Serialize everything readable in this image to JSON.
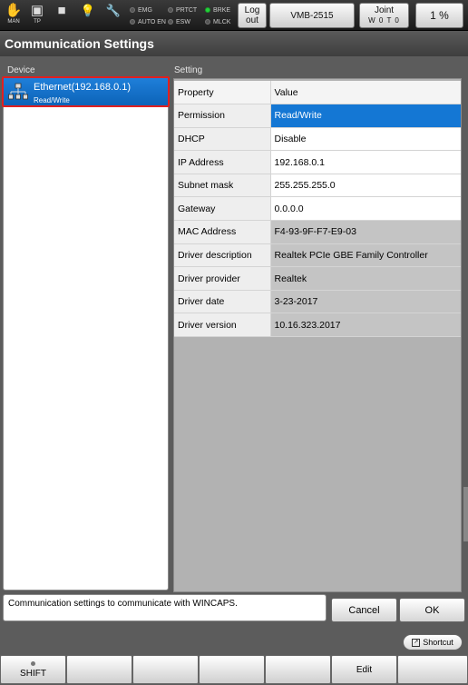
{
  "topbar": {
    "mode_icons": [
      {
        "name": "man-mode-icon",
        "label": "MAN",
        "glyph": "✋"
      },
      {
        "name": "teach-pendant-icon",
        "label": "TP",
        "glyph": "▣"
      },
      {
        "name": "stop-icon",
        "label": "",
        "glyph": "■"
      },
      {
        "name": "lightbulb-icon",
        "label": "",
        "glyph": "💡"
      },
      {
        "name": "wrench-icon",
        "label": "",
        "glyph": "🔧"
      }
    ],
    "indicators": {
      "emg": "EMG",
      "auto_en": "AUTO EN",
      "prtct": "PRTCT",
      "esw": "ESW",
      "brke": "BRKE",
      "mlck": "MLCK"
    },
    "logout_label": "Log\nout",
    "robot_label": "VMB-2515",
    "joint_label": "Joint",
    "joint_sub": "W 0 T 0",
    "speed_label": "1 %"
  },
  "title": "Communication Settings",
  "device_section_label": "Device",
  "setting_section_label": "Setting",
  "devices": [
    {
      "name": "Ethernet(192.168.0.1)",
      "permission": "Read/Write"
    }
  ],
  "settings": {
    "header": {
      "property": "Property",
      "value": "Value"
    },
    "rows": [
      {
        "property": "Permission",
        "value": "Read/Write"
      },
      {
        "property": "DHCP",
        "value": "Disable"
      },
      {
        "property": "IP Address",
        "value": "192.168.0.1"
      },
      {
        "property": "Subnet mask",
        "value": "255.255.255.0"
      },
      {
        "property": "Gateway",
        "value": "0.0.0.0"
      },
      {
        "property": "MAC Address",
        "value": "F4-93-9F-F7-E9-03"
      },
      {
        "property": "Driver description",
        "value": "Realtek PCIe GBE Family Controller"
      },
      {
        "property": "Driver provider",
        "value": "Realtek"
      },
      {
        "property": "Driver date",
        "value": "3-23-2017"
      },
      {
        "property": "Driver version",
        "value": "10.16.323.2017"
      }
    ]
  },
  "message": "Communication settings to communicate with WINCAPS.",
  "buttons": {
    "cancel": "Cancel",
    "ok": "OK",
    "shortcut": "Shortcut"
  },
  "fkeys": [
    "SHIFT",
    "",
    "",
    "",
    "",
    "Edit",
    ""
  ],
  "colors": {
    "selection": "#1477d4",
    "highlight_border": "#e02020",
    "indicator_on": "#23d23a"
  }
}
